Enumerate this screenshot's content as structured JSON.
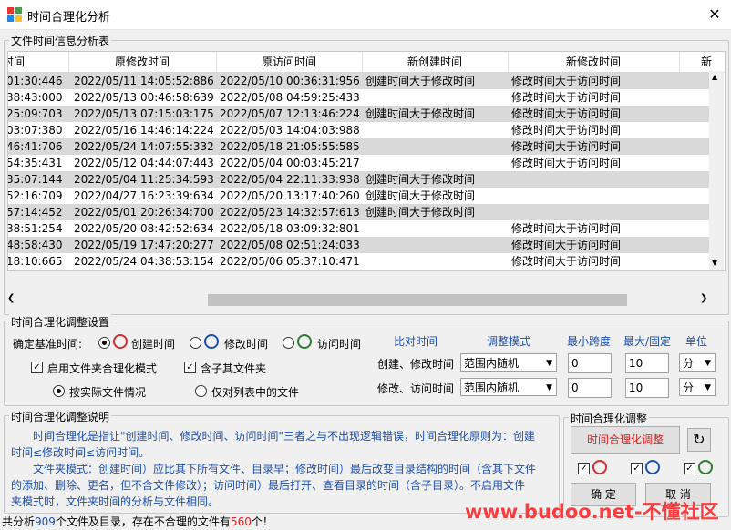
{
  "window": {
    "title": "时间合理化分析",
    "close": "✕"
  },
  "table_group": {
    "title": "文件时间信息分析表"
  },
  "table": {
    "headers": [
      "时间",
      "原修改时间",
      "原访问时间",
      "新创建时间",
      "新修改时间",
      "新"
    ],
    "rows": [
      [
        "01:30:446",
        "2022/05/11 14:05:52:886",
        "2022/05/10 00:36:31:956",
        "创建时间大于修改时间",
        "修改时间大于访问时间"
      ],
      [
        "38:43:000",
        "2022/05/13 00:46:58:639",
        "2022/05/08 04:59:25:433",
        "",
        "修改时间大于访问时间"
      ],
      [
        "25:09:703",
        "2022/05/13 07:15:03:175",
        "2022/05/07 12:13:46:224",
        "创建时间大于修改时间",
        "修改时间大于访问时间"
      ],
      [
        "03:07:380",
        "2022/05/16 14:46:14:224",
        "2022/05/03 14:04:03:988",
        "",
        "修改时间大于访问时间"
      ],
      [
        "46:41:706",
        "2022/05/24 14:07:55:332",
        "2022/05/18 21:05:55:585",
        "",
        "修改时间大于访问时间"
      ],
      [
        "54:35:431",
        "2022/05/12 04:44:07:443",
        "2022/05/04 00:03:45:217",
        "",
        "修改时间大于访问时间"
      ],
      [
        "35:07:144",
        "2022/05/04 11:25:34:593",
        "2022/05/04 22:11:33:938",
        "创建时间大于修改时间",
        ""
      ],
      [
        "52:16:709",
        "2022/04/27 16:23:39:634",
        "2022/05/20 13:17:40:260",
        "创建时间大于修改时间",
        ""
      ],
      [
        "57:14:452",
        "2022/05/01 20:26:34:700",
        "2022/05/23 14:32:57:613",
        "创建时间大于修改时间",
        ""
      ],
      [
        "38:51:254",
        "2022/05/20 08:42:52:634",
        "2022/05/18 03:09:32:801",
        "",
        "修改时间大于访问时间"
      ],
      [
        "48:58:430",
        "2022/05/19 17:47:20:277",
        "2022/05/08 02:51:24:033",
        "",
        "修改时间大于访问时间"
      ],
      [
        "18:10:665",
        "2022/05/24 04:38:53:154",
        "2022/05/06 05:37:10:471",
        "",
        "修改时间大于访问时间"
      ]
    ]
  },
  "settings": {
    "title": "时间合理化调整设置",
    "base_label": "确定基准时间:",
    "base_options": [
      "创建时间",
      "修改时间",
      "访问时间"
    ],
    "folder_mode": "启用文件夹合理化模式",
    "include_sub": "含子其文件夹",
    "by_actual": "按实际文件情况",
    "by_list": "仅对列表中的文件",
    "col_headers": [
      "比对时间",
      "调整模式",
      "最小跨度",
      "最大/固定",
      "单位"
    ],
    "rows": [
      {
        "label": "创建、修改时间",
        "mode": "范围内随机",
        "min": "0",
        "max": "10",
        "unit": "分"
      },
      {
        "label": "修改、访问时间",
        "mode": "范围内随机",
        "min": "0",
        "max": "10",
        "unit": "分"
      }
    ]
  },
  "desc": {
    "title": "时间合理化调整说明",
    "lines": [
      "　　时间合理化是指让\"创建时间、修改时间、访问时间\"三者之与不出现逻辑错误，时间合理化原则为：创建",
      "时间≤修改时间≤访问时间。",
      "　　文件夹模式：创建时间）应比其下所有文件、目录早；修改时间）最后改变目录结构的时间（含其下文件",
      "的添加、删除、更名，但不含文件修改）；访问时间）最后打开、查看目录的时间（含子目录）。不启用文件",
      "夹模式时，文件夹时间的分析与文件相同。"
    ]
  },
  "adjust": {
    "title": "时间合理化调整",
    "button": "时间合理化调整",
    "ok": "确 定",
    "cancel": "取 消"
  },
  "status": {
    "prefix": "共分析",
    "files": "909",
    "mid": "个文件及目录，存在不合理的文件有",
    "bad": "560",
    "suffix": "个！"
  },
  "watermark": "www.budoo.net-不懂社区",
  "colors": {
    "red": "#e02020",
    "blue": "#1c4fb0",
    "row_gray": "#d9d9d9"
  }
}
